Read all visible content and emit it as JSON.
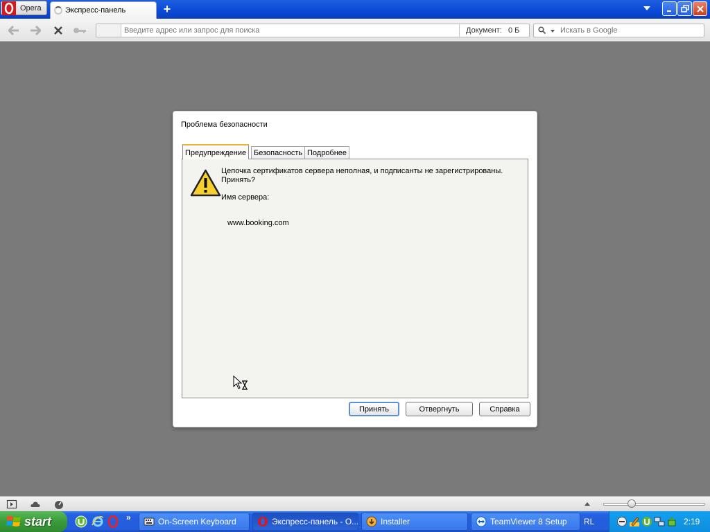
{
  "browser": {
    "menu_label": "Opera",
    "tab_title": "Экспресс-панель",
    "new_tab_label": "+",
    "address_placeholder": "Введите адрес или запрос для поиска",
    "document_label": "Документ:",
    "document_size": "0 Б",
    "search_placeholder": "Искать в Google"
  },
  "dialog": {
    "title": "Проблема безопасности",
    "tabs": [
      "Предупреждение",
      "Безопасность",
      "Подробнее"
    ],
    "message": "Цепочка сертификатов сервера неполная, и подписанты не зарегистрированы. Принять?",
    "server_label": "Имя сервера:",
    "server_name": "www.booking.com",
    "buttons": {
      "accept": "Принять",
      "reject": "Отвергнуть",
      "help": "Справка"
    }
  },
  "taskbar": {
    "start_label": "start",
    "quick_more": "»",
    "tasks": [
      {
        "label": "On-Screen Keyboard",
        "icon": "keyboard-icon"
      },
      {
        "label": "Экспресс-панель - О...",
        "icon": "opera-icon"
      },
      {
        "label": "Installer",
        "icon": "installer-icon"
      },
      {
        "label": "TeamViewer 8 Setup",
        "icon": "teamviewer-icon"
      }
    ],
    "language": "RL",
    "clock": "2:19"
  },
  "colors": {
    "xp_taskbar": "#245ddb",
    "start_green": "#3a9b3a",
    "tab_accent": "#f0b232",
    "window_backdrop": "#7a7a7a"
  }
}
